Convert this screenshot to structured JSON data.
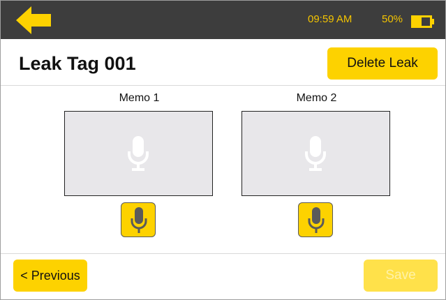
{
  "status_bar": {
    "time": "09:59 AM",
    "battery": "50%",
    "accent_color": "#f4c400",
    "back_icon": "arrow-left-icon",
    "battery_icon": "battery-half-icon"
  },
  "header": {
    "title": "Leak Tag 001",
    "delete_label": "Delete Leak"
  },
  "memos": [
    {
      "label": "Memo 1",
      "placeholder_icon": "microphone-icon",
      "record_icon": "microphone-icon"
    },
    {
      "label": "Memo 2",
      "placeholder_icon": "microphone-icon",
      "record_icon": "microphone-icon"
    }
  ],
  "footer": {
    "previous_label": "< Previous",
    "save_label": "Save",
    "save_enabled": false
  },
  "colors": {
    "button_yellow": "#fdd200",
    "disabled_yellow": "#ffe14a",
    "topbar": "#3d3d3d"
  }
}
